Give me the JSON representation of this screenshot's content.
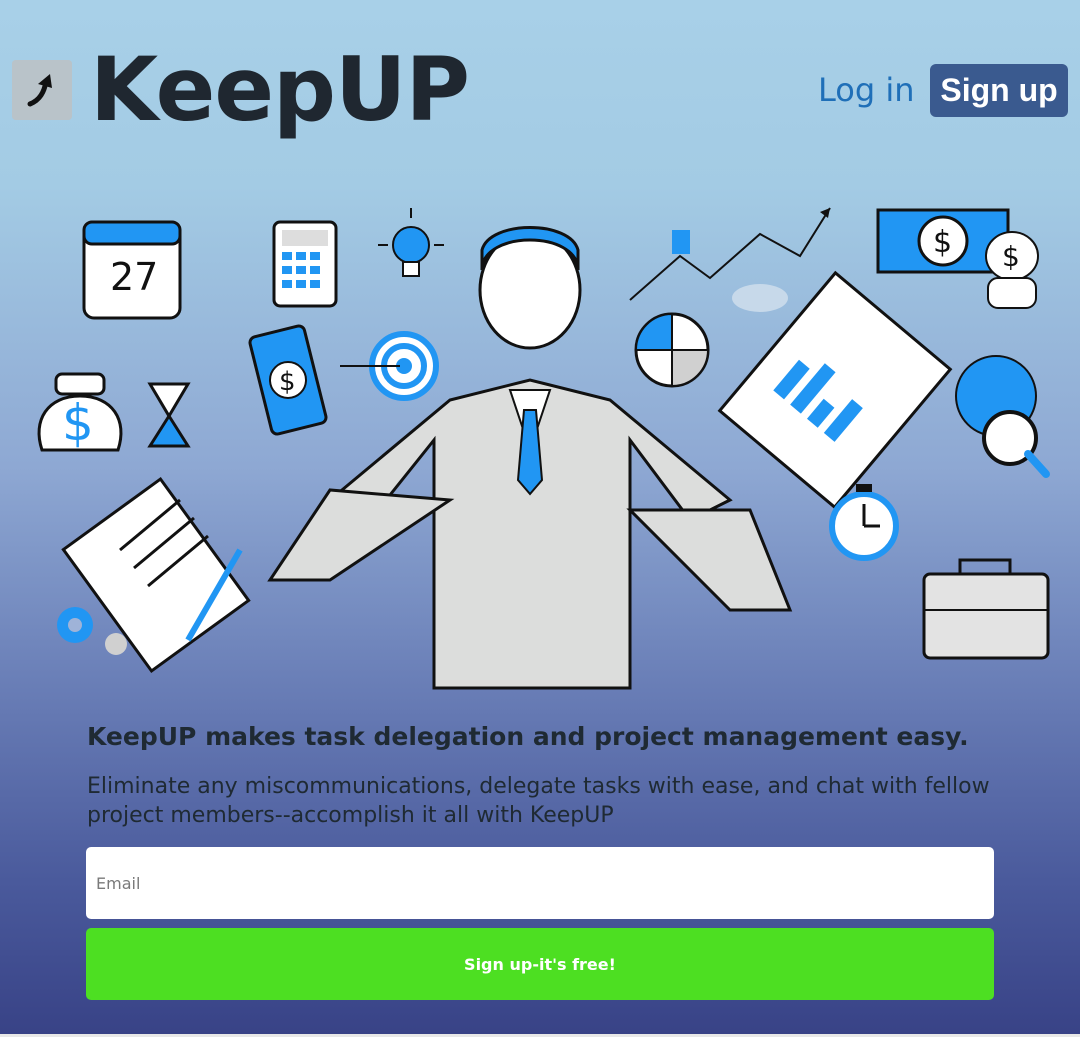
{
  "brand": {
    "name": "KeepUP",
    "logo_icon": "upward-arrow-icon"
  },
  "nav": {
    "login_label": "Log in",
    "signup_label": "Sign up"
  },
  "hero": {
    "calendar_day": "27",
    "currency_symbol": "$"
  },
  "content": {
    "headline": "KeepUP makes task delegation and project management easy.",
    "subtext": "Eliminate any miscommunications, delegate tasks with ease, and chat with fellow project members--accomplish it all with KeepUP"
  },
  "form": {
    "email_placeholder": "Email",
    "cta_label": "Sign up-it's free!"
  },
  "colors": {
    "accent_blue": "#2196f3",
    "brand_dark": "#3a5a8f",
    "cta_green": "#4ddf22"
  }
}
